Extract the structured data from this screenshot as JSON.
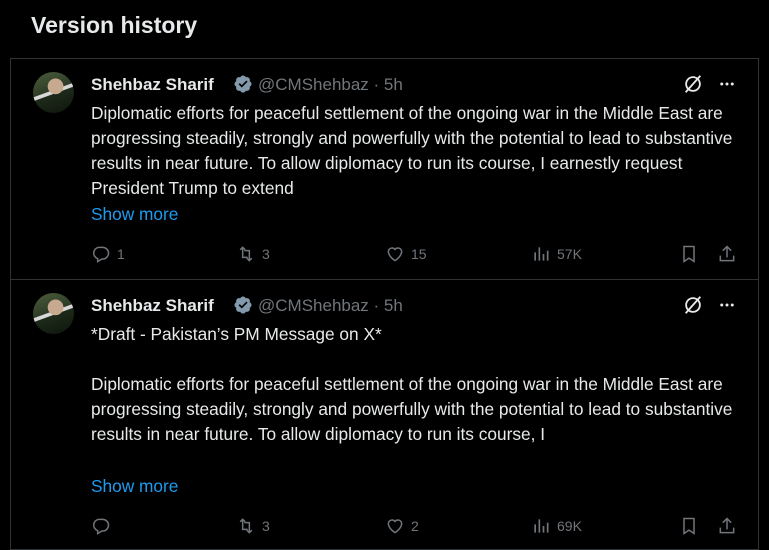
{
  "header": {
    "title": "Version history"
  },
  "colors": {
    "background": "#000000",
    "text": "#e7e9ea",
    "muted": "#71767b",
    "link": "#1d9bf0",
    "verified": "#829aab"
  },
  "tweets": [
    {
      "author": "Shehbaz Sharif",
      "handle": "@CMShehbaz · 5h",
      "text": "Diplomatic efforts for peaceful settlement of the ongoing war in the Middle East are progressing steadily, strongly and powerfully with the potential to lead to substantive results in near future. To allow diplomacy to run its course, I earnestly request President Trump to extend",
      "show_more": "Show more",
      "replies": "1",
      "retweets": "3",
      "likes": "15",
      "views": "57K"
    },
    {
      "author": "Shehbaz Sharif",
      "handle": "@CMShehbaz · 5h",
      "text": "*Draft - Pakistan’s PM Message on X*\n\nDiplomatic efforts for peaceful settlement of the ongoing war in the Middle East are progressing steadily, strongly and powerfully with the potential to lead to substantive results in near future. To allow diplomacy to run its course, I",
      "show_more": "Show more",
      "replies": "",
      "retweets": "3",
      "likes": "2",
      "views": "69K"
    }
  ]
}
